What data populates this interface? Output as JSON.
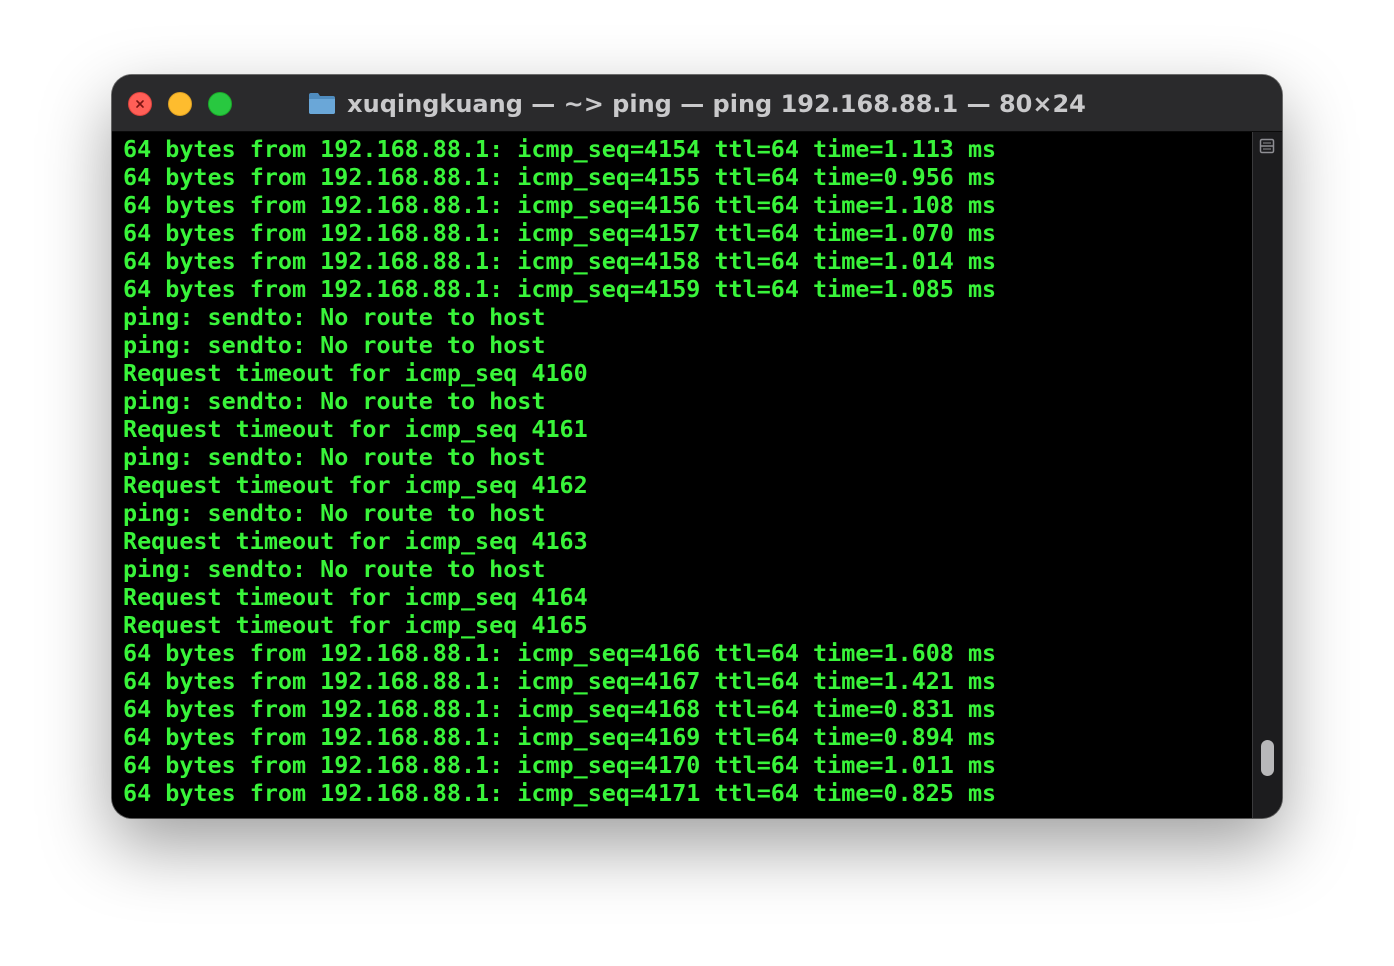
{
  "window": {
    "title": "xuqingkuang — ~> ping — ping 192.168.88.1 — 80×24",
    "controls": {
      "close": "close",
      "minimize": "minimize",
      "zoom": "zoom"
    },
    "title_icon": "folder-icon"
  },
  "colors": {
    "terminal_background": "#000000",
    "terminal_text": "#39f43a",
    "titlebar": "#2a2a2c",
    "close": "#ff5f57",
    "minimize": "#febc2e",
    "zoom": "#28c840"
  },
  "terminal": {
    "lines": [
      "64 bytes from 192.168.88.1: icmp_seq=4154 ttl=64 time=1.113 ms",
      "64 bytes from 192.168.88.1: icmp_seq=4155 ttl=64 time=0.956 ms",
      "64 bytes from 192.168.88.1: icmp_seq=4156 ttl=64 time=1.108 ms",
      "64 bytes from 192.168.88.1: icmp_seq=4157 ttl=64 time=1.070 ms",
      "64 bytes from 192.168.88.1: icmp_seq=4158 ttl=64 time=1.014 ms",
      "64 bytes from 192.168.88.1: icmp_seq=4159 ttl=64 time=1.085 ms",
      "ping: sendto: No route to host",
      "ping: sendto: No route to host",
      "Request timeout for icmp_seq 4160",
      "ping: sendto: No route to host",
      "Request timeout for icmp_seq 4161",
      "ping: sendto: No route to host",
      "Request timeout for icmp_seq 4162",
      "ping: sendto: No route to host",
      "Request timeout for icmp_seq 4163",
      "ping: sendto: No route to host",
      "Request timeout for icmp_seq 4164",
      "Request timeout for icmp_seq 4165",
      "64 bytes from 192.168.88.1: icmp_seq=4166 ttl=64 time=1.608 ms",
      "64 bytes from 192.168.88.1: icmp_seq=4167 ttl=64 time=1.421 ms",
      "64 bytes from 192.168.88.1: icmp_seq=4168 ttl=64 time=0.831 ms",
      "64 bytes from 192.168.88.1: icmp_seq=4169 ttl=64 time=0.894 ms",
      "64 bytes from 192.168.88.1: icmp_seq=4170 ttl=64 time=1.011 ms",
      "64 bytes from 192.168.88.1: icmp_seq=4171 ttl=64 time=0.825 ms"
    ]
  },
  "scrollbar": {
    "split_icon": "split-view-icon",
    "position_fraction": 0.95
  }
}
